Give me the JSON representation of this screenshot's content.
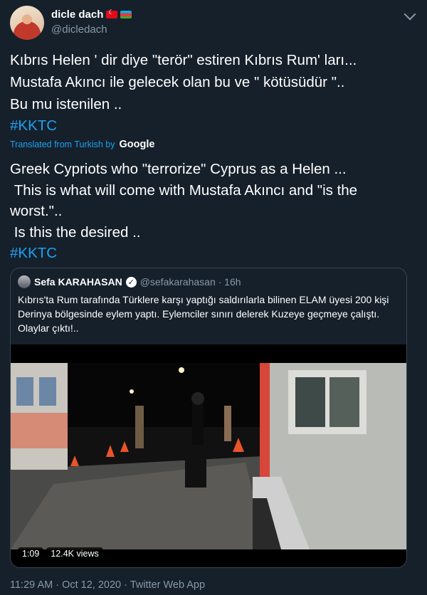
{
  "user": {
    "display_name": "dicle dach",
    "handle": "@dicledach"
  },
  "tweet": {
    "lines": [
      "Kıbrıs Helen ' dir diye \"terör\" estiren Kıbrıs Rum' ları...",
      "Mustafa Akıncı ile gelecek olan bu ve \" kötüsüdür \"..",
      "Bu mu istenilen .."
    ],
    "hashtag": "#KKTC"
  },
  "translation": {
    "label": "Translated from Turkish by",
    "provider": "Google",
    "lines": [
      "Greek Cypriots who \"terrorize\" Cyprus as a Helen ...",
      " This is what will come with Mustafa Akıncı and \"is the",
      "worst.\"..",
      " Is this the desired .."
    ],
    "hashtag": "#KKTC"
  },
  "quoted": {
    "name": "Sefa KARAHASAN",
    "handle": "@sefakarahasan · 16h",
    "text": "Kıbrıs'ta Rum tarafında Türklere karşı yaptığı saldırılarla bilinen ELAM üyesi 200 kişi Derinya bölgesinde eylem yaptı. Eylemciler sınırı delerek Kuzeye geçmeye çalıştı. Olaylar çıktı!..",
    "video": {
      "duration": "1:09",
      "views": "12.4K views"
    }
  },
  "footer": {
    "meta": "11:29 AM · Oct 12, 2020 · Twitter Web App"
  },
  "colors": {
    "background": "#15202b",
    "link": "#1da1f2",
    "muted": "#8899a6",
    "border": "#38444d"
  },
  "icons": [
    "chevron-down-icon",
    "verified-badge-icon",
    "flag-turkey-icon",
    "flag-azerbaijan-icon"
  ]
}
